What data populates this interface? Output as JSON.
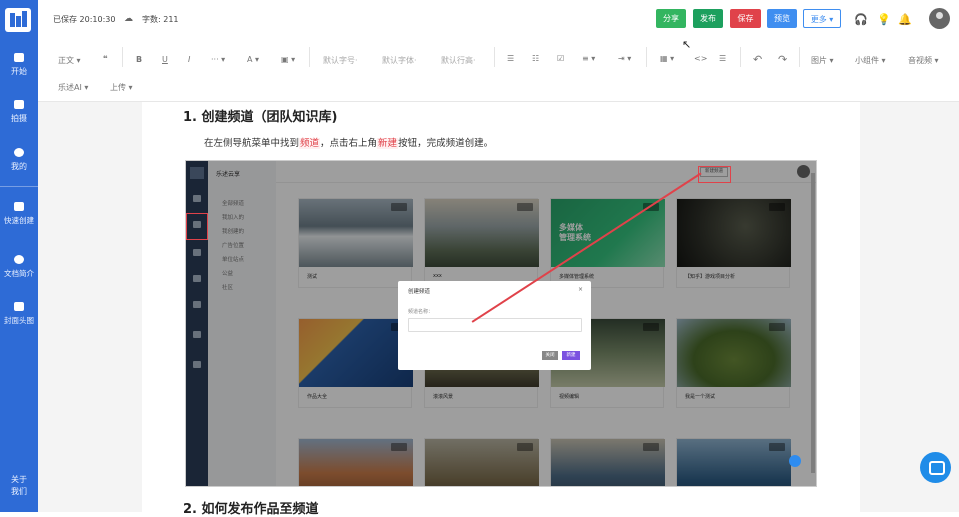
{
  "sidebar": {
    "items": [
      {
        "label": "开始",
        "icon": "cloud-icon"
      },
      {
        "label": "拍摄",
        "icon": "camera-icon"
      },
      {
        "label": "我的",
        "icon": "user-icon"
      },
      {
        "label": "快速创建",
        "icon": "add-file-icon"
      },
      {
        "label": "文档简介",
        "icon": "info-icon"
      },
      {
        "label": "封面头图",
        "icon": "image-icon"
      }
    ],
    "about": [
      "关于",
      "我们"
    ]
  },
  "topbar": {
    "saved": "已保存 20:10:30",
    "wordcount": "字数: 211",
    "share": "分享",
    "publish": "发布",
    "save": "保存",
    "preview": "预览",
    "more": "更多"
  },
  "toolbar": {
    "style": "正文",
    "font_size": "默认字号",
    "font_family": "默认字体",
    "line_height": "默认行高",
    "image": "图片",
    "widget": "小组件",
    "audio_video": "音视频",
    "ai": "乐述AI",
    "upload": "上传"
  },
  "doc": {
    "heading1": "1. 创建频道（团队知识库)",
    "para_a": "在左侧导航菜单中找到",
    "para_hl1": "频道",
    "para_b": "，点击右上角",
    "para_hl2": "新建",
    "para_c": "按钮，完成频道创建。",
    "heading2": "2. 如何发布作品至频道"
  },
  "shot": {
    "app_name": "乐述云享",
    "new_btn": "新建频道",
    "nav_items": [
      "全部频道",
      "我加入的",
      "我创建的",
      "广告位置",
      "单位站点",
      "公益",
      "社区"
    ],
    "cards_row1": [
      "测试",
      "xxx",
      "多媒体管理系统",
      "【知乎】游戏项目分析"
    ],
    "cards_row2": [
      "作品大全",
      "滚滚风景",
      "视频编辑",
      "我是一个测试"
    ],
    "card_tag": "运营",
    "banner_text": [
      "多媒体",
      "管理系统"
    ],
    "modal_title": "创建频道",
    "modal_close": "×",
    "modal_label": "频道名称：",
    "modal_cancel": "关闭",
    "modal_ok": "新建"
  },
  "colors": {
    "primary": "#2e6bd6",
    "share": "#33b560",
    "publish": "#1da05e",
    "save": "#e0424a",
    "preview": "#3f8ef0",
    "highlight_text": "#e0424a"
  }
}
